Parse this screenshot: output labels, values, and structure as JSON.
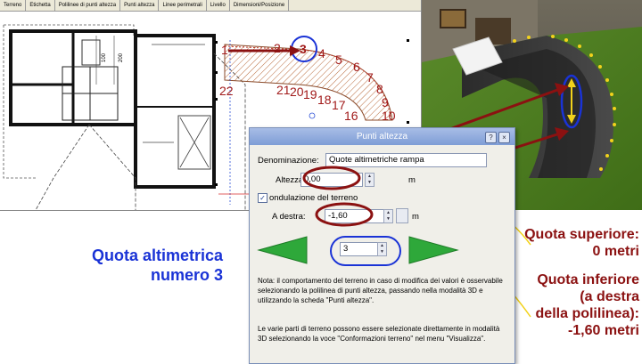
{
  "toolbar": {
    "tabs": [
      "Terreno",
      "Etichetta",
      "Polilinee di punti altezza",
      "Punti altezza",
      "Linee perimetrali",
      "Livello",
      "Dimensioni/Posizione"
    ]
  },
  "plan": {
    "dim_left": "100",
    "dim_right": "200",
    "point_labels": [
      "1",
      "2",
      "3",
      "4",
      "5",
      "6",
      "7",
      "8",
      "9",
      "10",
      "16",
      "17",
      "18",
      "19",
      "20",
      "21",
      "22"
    ]
  },
  "dialog": {
    "title": "Punti altezza",
    "help_label": "?",
    "close_label": "×",
    "name_label": "Denominazione:",
    "name_value": "Quote altimetriche rampa",
    "height_label": "Altezza",
    "height_value": "0,00",
    "height_unit": "m",
    "terrain_label": "ondulazione del terreno",
    "terrain_checked": true,
    "right_label": "A destra:",
    "right_value": "-1,60",
    "right_unit": "m",
    "point_number": "3",
    "note1": "Nota: il comportamento del terreno in caso di modifica dei valori è osservabile selezionando la polilinea di punti altezza, passando nella modalità 3D e utilizzando la scheda \"Punti altezza\".",
    "note2": "Le varie parti di terreno possono essere selezionate direttamente in modalità 3D selezionando la voce \"Conformazioni terreno\" nel menu \"Visualizza\"."
  },
  "captions": {
    "blue_line1": "Quota altimetrica",
    "blue_line2": "numero 3",
    "upper_line1": "Quota superiore:",
    "upper_line2": "0 metri",
    "lower_line1": "Quota inferiore",
    "lower_line2": "(a destra",
    "lower_line3": "della polilinea):",
    "lower_line4": "-1,60 metri"
  },
  "colors": {
    "blue_caption": "#1a33d6",
    "dark_red": "#8b1111",
    "point_label": "#a11a1a",
    "yellow": "#f2d21b",
    "arrow_green": "#2ea83a"
  }
}
